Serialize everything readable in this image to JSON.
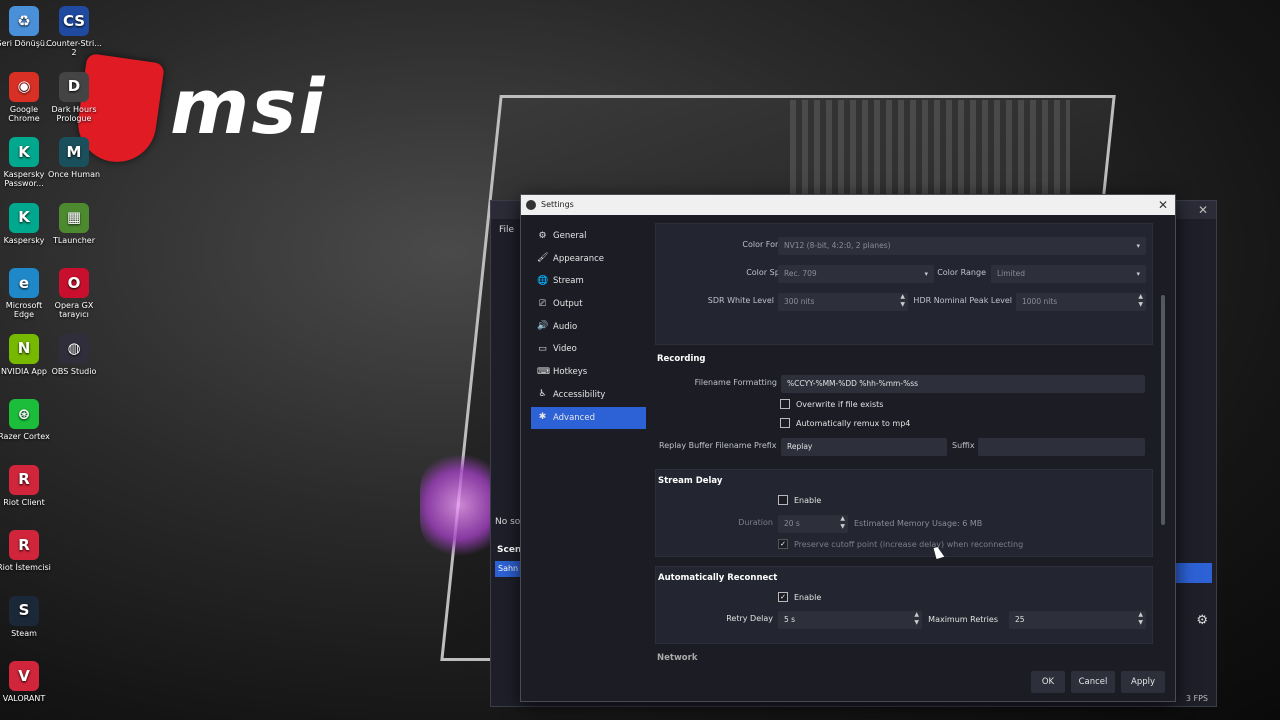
{
  "desktop": {
    "wallpaper_logo": "msi",
    "icons": [
      {
        "label": "Geri Dönüşü...",
        "icon": "recycle-bin-icon",
        "color": "#4a90d9",
        "glyph": "♻"
      },
      {
        "label": "Counter-Stri... 2",
        "icon": "counter-strike-icon",
        "color": "#1f4aa0",
        "glyph": "CS"
      },
      {
        "label": "Google Chrome",
        "icon": "chrome-icon",
        "color": "#d93025",
        "glyph": "◉"
      },
      {
        "label": "Dark Hours Prologue",
        "icon": "dark-hours-icon",
        "color": "#444444",
        "glyph": "D"
      },
      {
        "label": "Kaspersky Passwor...",
        "icon": "kaspersky-password-icon",
        "color": "#00a88e",
        "glyph": "K"
      },
      {
        "label": "Once Human",
        "icon": "once-human-icon",
        "color": "#1a4f5c",
        "glyph": "M"
      },
      {
        "label": "Kaspersky",
        "icon": "kaspersky-icon",
        "color": "#00a88e",
        "glyph": "K"
      },
      {
        "label": "TLauncher",
        "icon": "tlauncher-icon",
        "color": "#4d8a2f",
        "glyph": "▦"
      },
      {
        "label": "Microsoft Edge",
        "icon": "edge-icon",
        "color": "#1e88c8",
        "glyph": "e"
      },
      {
        "label": "Opera GX tarayıcı",
        "icon": "opera-gx-icon",
        "color": "#c8102e",
        "glyph": "O"
      },
      {
        "label": "NVIDIA App",
        "icon": "nvidia-icon",
        "color": "#76b900",
        "glyph": "N"
      },
      {
        "label": "OBS Studio",
        "icon": "obs-studio-icon",
        "color": "#302e3a",
        "glyph": "◍"
      },
      {
        "label": "Razer Cortex",
        "icon": "razer-cortex-icon",
        "color": "#1bbd3a",
        "glyph": "⊛"
      },
      {
        "label": "Riot Client",
        "icon": "riot-client-icon",
        "color": "#d0253a",
        "glyph": "R"
      },
      {
        "label": "Riot İstemcisi",
        "icon": "riot-istemcisi-icon",
        "color": "#d0253a",
        "glyph": "R"
      },
      {
        "label": "Steam",
        "icon": "steam-icon",
        "color": "#1b2838",
        "glyph": "S"
      },
      {
        "label": "VALORANT",
        "icon": "valorant-icon",
        "color": "#d0253a",
        "glyph": "V"
      }
    ]
  },
  "obs_main": {
    "menu_file": "File",
    "no_source": "No so",
    "scenes_header": "Scene",
    "scene_item": "Sahn",
    "fps_text": "3 FPS"
  },
  "settings": {
    "title": "Settings",
    "nav": [
      {
        "label": "General",
        "icon": "gear-icon",
        "glyph": "⚙"
      },
      {
        "label": "Appearance",
        "icon": "brush-icon",
        "glyph": "🖌"
      },
      {
        "label": "Stream",
        "icon": "globe-icon",
        "glyph": "🌐"
      },
      {
        "label": "Output",
        "icon": "output-icon",
        "glyph": "⎚"
      },
      {
        "label": "Audio",
        "icon": "speaker-icon",
        "glyph": "🔊"
      },
      {
        "label": "Video",
        "icon": "monitor-icon",
        "glyph": "▭"
      },
      {
        "label": "Hotkeys",
        "icon": "keyboard-icon",
        "glyph": "⌨"
      },
      {
        "label": "Accessibility",
        "icon": "accessibility-icon",
        "glyph": "♿"
      },
      {
        "label": "Advanced",
        "icon": "wrench-icon",
        "glyph": "✱",
        "active": true
      }
    ],
    "video": {
      "color_format_label": "Color Format",
      "color_format_value": "NV12 (8-bit, 4:2:0, 2 planes)",
      "color_space_label": "Color Space",
      "color_space_value": "Rec. 709",
      "color_range_label": "Color Range",
      "color_range_value": "Limited",
      "sdr_label": "SDR White Level",
      "sdr_value": "300 nits",
      "hdr_label": "HDR Nominal Peak Level",
      "hdr_value": "1000 nits"
    },
    "recording": {
      "title": "Recording",
      "filename_label": "Filename Formatting",
      "filename_value": "%CCYY-%MM-%DD %hh-%mm-%ss",
      "overwrite_label": "Overwrite if file exists",
      "remux_label": "Automatically remux to mp4",
      "replay_prefix_label": "Replay Buffer Filename Prefix",
      "replay_prefix_value": "Replay",
      "suffix_label": "Suffix",
      "suffix_value": ""
    },
    "stream_delay": {
      "title": "Stream Delay",
      "enable_label": "Enable",
      "duration_label": "Duration",
      "duration_value": "20 s",
      "memory_text": "Estimated Memory Usage: 6 MB",
      "preserve_label": "Preserve cutoff point (increase delay) when reconnecting"
    },
    "reconnect": {
      "title": "Automatically Reconnect",
      "enable_label": "Enable",
      "retry_delay_label": "Retry Delay",
      "retry_delay_value": "5 s",
      "max_retries_label": "Maximum Retries",
      "max_retries_value": "25"
    },
    "network": {
      "title": "Network"
    },
    "buttons": {
      "ok": "OK",
      "cancel": "Cancel",
      "apply": "Apply"
    },
    "icons": {
      "dropdown": "▾",
      "spin_up": "▲",
      "spin_down": "▼",
      "check": "✓",
      "close": "✕"
    }
  }
}
